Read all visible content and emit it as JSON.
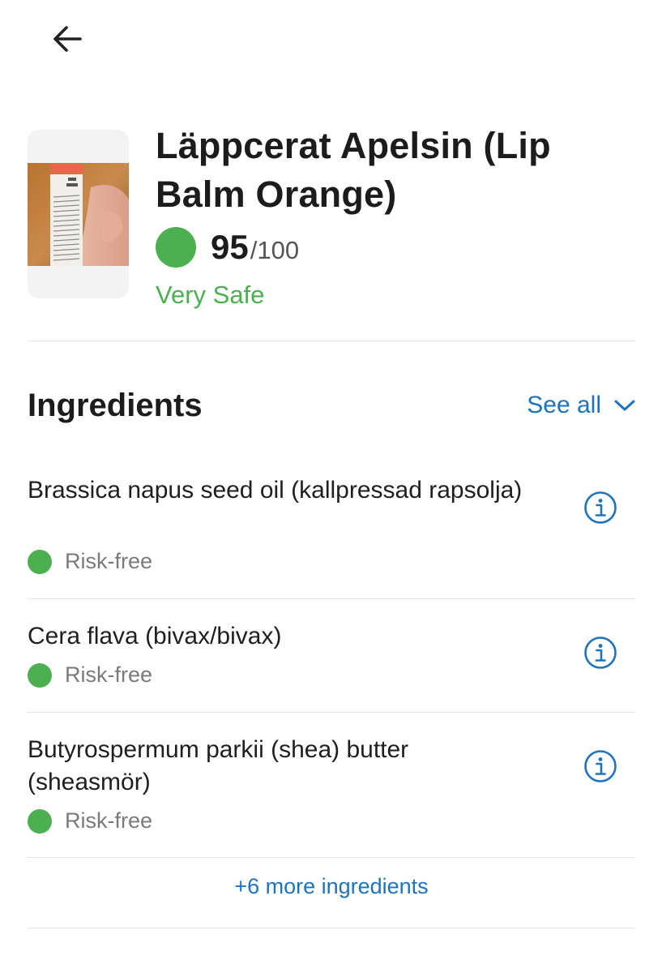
{
  "nav": {
    "back_icon": "arrow-left-icon"
  },
  "product": {
    "name": "Läppcerat Apelsin (Lip Balm Orange)",
    "score": "95",
    "score_max": "/100",
    "rating_label": "Very Safe",
    "rating_color": "#4caf50",
    "image_icon": "product-photo"
  },
  "ingredients": {
    "title": "Ingredients",
    "see_all_label": "See all",
    "see_all_icon": "chevron-down-icon",
    "accent_color": "#1e73be",
    "items": [
      {
        "name": "Brassica napus seed oil (kallpressad rapsolja)",
        "risk": "Risk-free",
        "info_icon": "info-icon"
      },
      {
        "name": "Cera flava (bivax/bivax)",
        "risk": "Risk-free",
        "info_icon": "info-icon"
      },
      {
        "name": "Butyrospermum parkii (shea) butter (sheasmör)",
        "risk": "Risk-free",
        "info_icon": "info-icon"
      }
    ],
    "more_label": "+6 more ingredients"
  }
}
